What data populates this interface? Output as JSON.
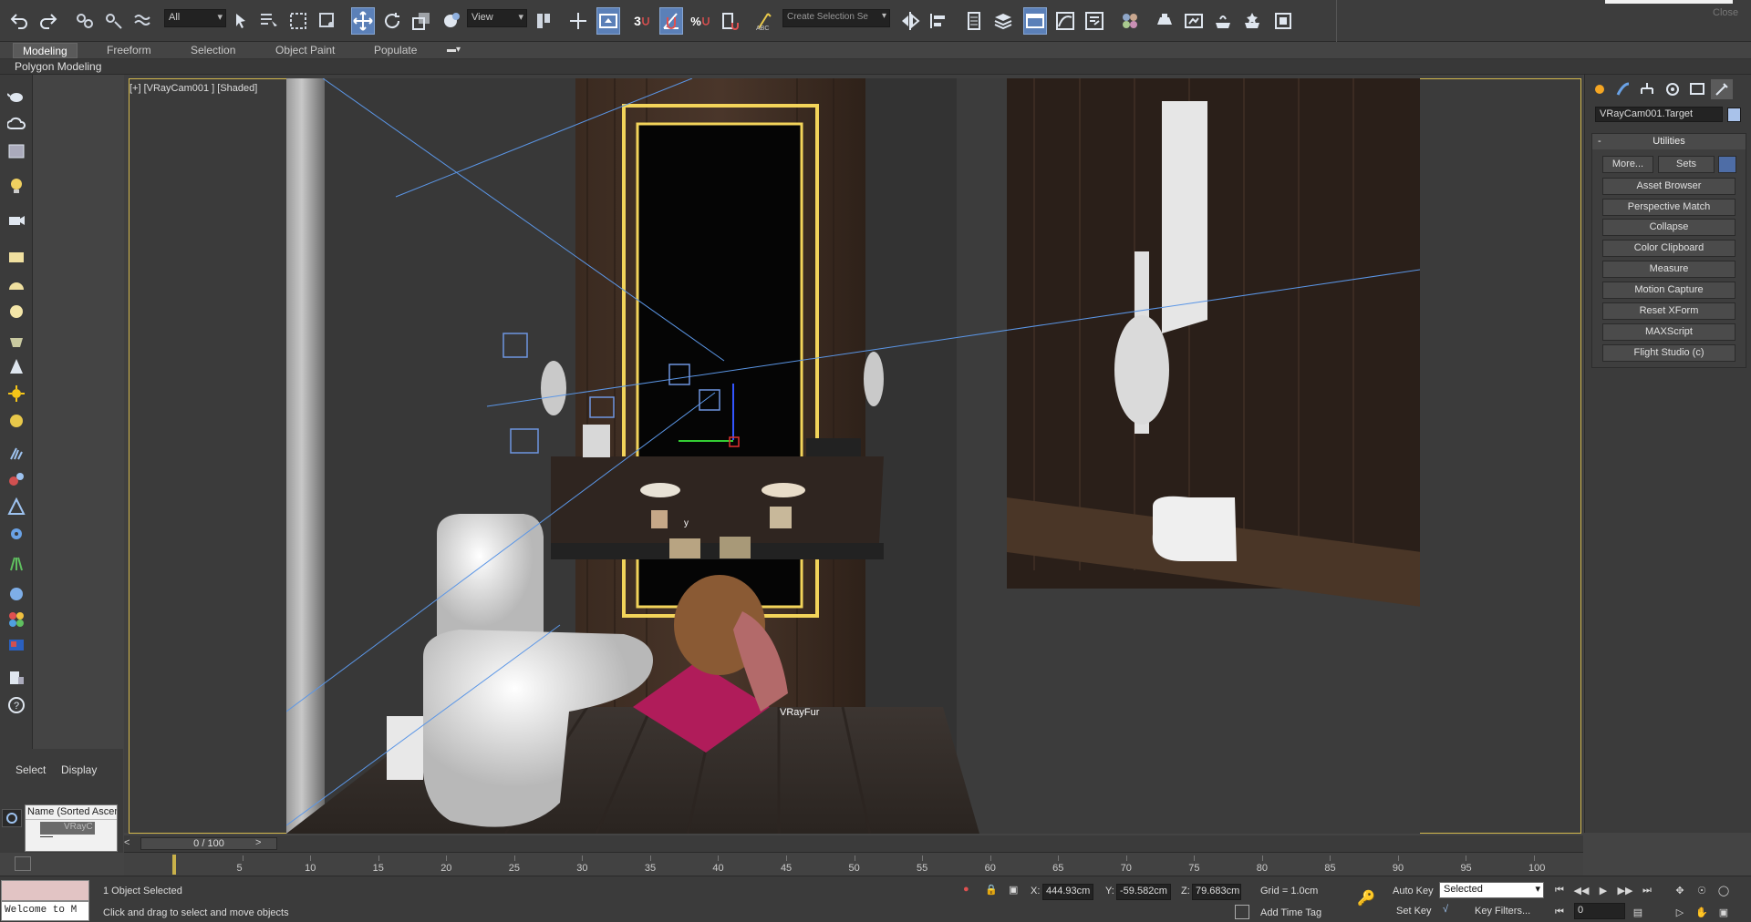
{
  "toolbar": {
    "filter_value": "All",
    "refcoord_value": "View",
    "selection_set_placeholder": "Create Selection Se",
    "snap_3_label": "3",
    "snap_angle_label": "∠",
    "snap_percent_label": "%",
    "close_label": "Close"
  },
  "ribbon": {
    "tabs": [
      "Modeling",
      "Freeform",
      "Selection",
      "Object Paint",
      "Populate"
    ],
    "panel_label": "Polygon Modeling"
  },
  "scene_explorer": {
    "tab_select": "Select",
    "tab_display": "Display",
    "column_header": "Name (Sorted Ascen",
    "item": "VRayC"
  },
  "viewport": {
    "label": "[+] [VRayCam001 ] [Shaded]",
    "object_label": "VRayFur",
    "axis_y": "y"
  },
  "command_panel": {
    "object_name": "VRayCam001.Target",
    "object_color": "#a9c2ea",
    "rollout_title": "Utilities",
    "collapse_sign": "-",
    "more_button": "More...",
    "sets_button": "Sets",
    "utilities": [
      "Asset Browser",
      "Perspective Match",
      "Collapse",
      "Color Clipboard",
      "Measure",
      "Motion Capture",
      "Reset XForm",
      "MAXScript",
      "Flight Studio (c)"
    ]
  },
  "timeline": {
    "frame_display": "0 / 100",
    "ticks": [
      "5",
      "10",
      "15",
      "20",
      "25",
      "30",
      "35",
      "40",
      "45",
      "50",
      "55",
      "60",
      "65",
      "70",
      "75",
      "80",
      "85",
      "90",
      "95",
      "100"
    ],
    "prev": "<",
    "next": ">"
  },
  "status": {
    "listener_text": "Welcome to M",
    "selection_text": "1 Object Selected",
    "prompt_text": "Click and drag to select and move objects",
    "x_label": "X:",
    "x_value": "444.93cm",
    "y_label": "Y:",
    "y_value": "-59.582cm",
    "z_label": "Z:",
    "z_value": "79.683cm",
    "grid_label": "Grid = 1.0cm",
    "add_time_tag": "Add Time Tag",
    "auto_key": "Auto Key",
    "set_key": "Set Key",
    "key_mode": "Selected",
    "key_filters": "Key Filters...",
    "current_frame": "0"
  },
  "colors": {
    "accent_active": "#5b80b8",
    "viewport_border": "#d4b94d",
    "mirror_frame": "#e8c84a"
  }
}
